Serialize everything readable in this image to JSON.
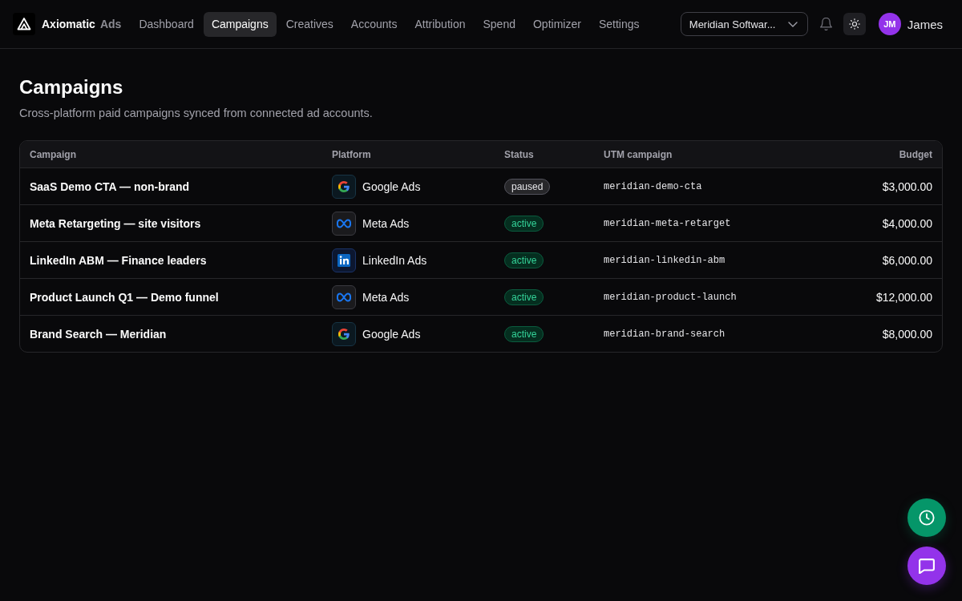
{
  "brand": {
    "name": "Axiomatic",
    "suffix": "Ads"
  },
  "nav": [
    {
      "label": "Dashboard",
      "selected": false
    },
    {
      "label": "Campaigns",
      "selected": true
    },
    {
      "label": "Creatives",
      "selected": false
    },
    {
      "label": "Accounts",
      "selected": false
    },
    {
      "label": "Attribution",
      "selected": false
    },
    {
      "label": "Spend",
      "selected": false
    },
    {
      "label": "Optimizer",
      "selected": false
    },
    {
      "label": "Settings",
      "selected": false
    }
  ],
  "account_select": {
    "value": "Meridian Softwar..."
  },
  "user": {
    "initials": "JM",
    "name": "James"
  },
  "page": {
    "title": "Campaigns",
    "subtitle": "Cross-platform paid campaigns synced from connected ad accounts."
  },
  "table": {
    "columns": [
      "Campaign",
      "Platform",
      "Status",
      "UTM campaign",
      "Budget"
    ],
    "rows": [
      {
        "campaign": "SaaS Demo CTA — non-brand",
        "platform": {
          "kind": "google",
          "name": "Google Ads"
        },
        "status": {
          "kind": "paused",
          "label": "paused"
        },
        "utm_campaign": "meridian-demo-cta",
        "budget": "$3,000.00"
      },
      {
        "campaign": "Meta Retargeting — site visitors",
        "platform": {
          "kind": "meta",
          "name": "Meta Ads"
        },
        "status": {
          "kind": "active",
          "label": "active"
        },
        "utm_campaign": "meridian-meta-retarget",
        "budget": "$4,000.00"
      },
      {
        "campaign": "LinkedIn ABM — Finance leaders",
        "platform": {
          "kind": "linkedin",
          "name": "LinkedIn Ads"
        },
        "status": {
          "kind": "active",
          "label": "active"
        },
        "utm_campaign": "meridian-linkedin-abm",
        "budget": "$6,000.00"
      },
      {
        "campaign": "Product Launch Q1 — Demo funnel",
        "platform": {
          "kind": "meta",
          "name": "Meta Ads"
        },
        "status": {
          "kind": "active",
          "label": "active"
        },
        "utm_campaign": "meridian-product-launch",
        "budget": "$12,000.00"
      },
      {
        "campaign": "Brand Search — Meridian",
        "platform": {
          "kind": "google",
          "name": "Google Ads"
        },
        "status": {
          "kind": "active",
          "label": "active"
        },
        "utm_campaign": "meridian-brand-search",
        "budget": "$8,000.00"
      }
    ]
  }
}
